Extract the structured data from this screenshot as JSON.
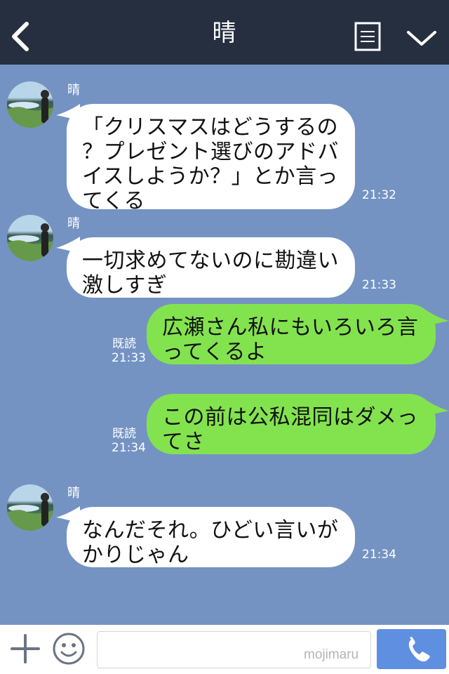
{
  "header": {
    "title": "晴",
    "back_icon": "chevron-left-icon",
    "notes_icon": "notes-icon",
    "menu_icon": "chevron-down-icon"
  },
  "messages": [
    {
      "type": "incoming",
      "sender": "晴",
      "text": "「クリスマスはどうするの\n？プレゼント選びのアドバ\nイスしようか？」とか言っ\nてくる",
      "time": "21:32"
    },
    {
      "type": "incoming",
      "sender": "晴",
      "text": "一切求めてないのに勘違い\n激しすぎ",
      "time": "21:33"
    },
    {
      "type": "outgoing",
      "read": "既読",
      "text": "広瀬さん私にもいろいろ言\nってくるよ",
      "time": "21:33"
    },
    {
      "type": "outgoing",
      "read": "既読",
      "text": "この前は公私混同はダメっ\nてさ",
      "time": "21:34"
    },
    {
      "type": "incoming",
      "sender": "晴",
      "text": "なんだそれ。ひどい言いが\nかりじゃん",
      "time": "21:34"
    }
  ],
  "footer": {
    "plus_icon": "plus-icon",
    "emoji_icon": "emoji-icon",
    "input_value": "",
    "input_placeholder": "",
    "call_icon": "phone-icon",
    "watermark": "mojimaru"
  },
  "colors": {
    "header": "#262f40",
    "chat_background": "#7493c3",
    "incoming_bubble": "#ffffff",
    "outgoing_bubble": "#83e34f",
    "call_button": "#5f8fe0"
  }
}
